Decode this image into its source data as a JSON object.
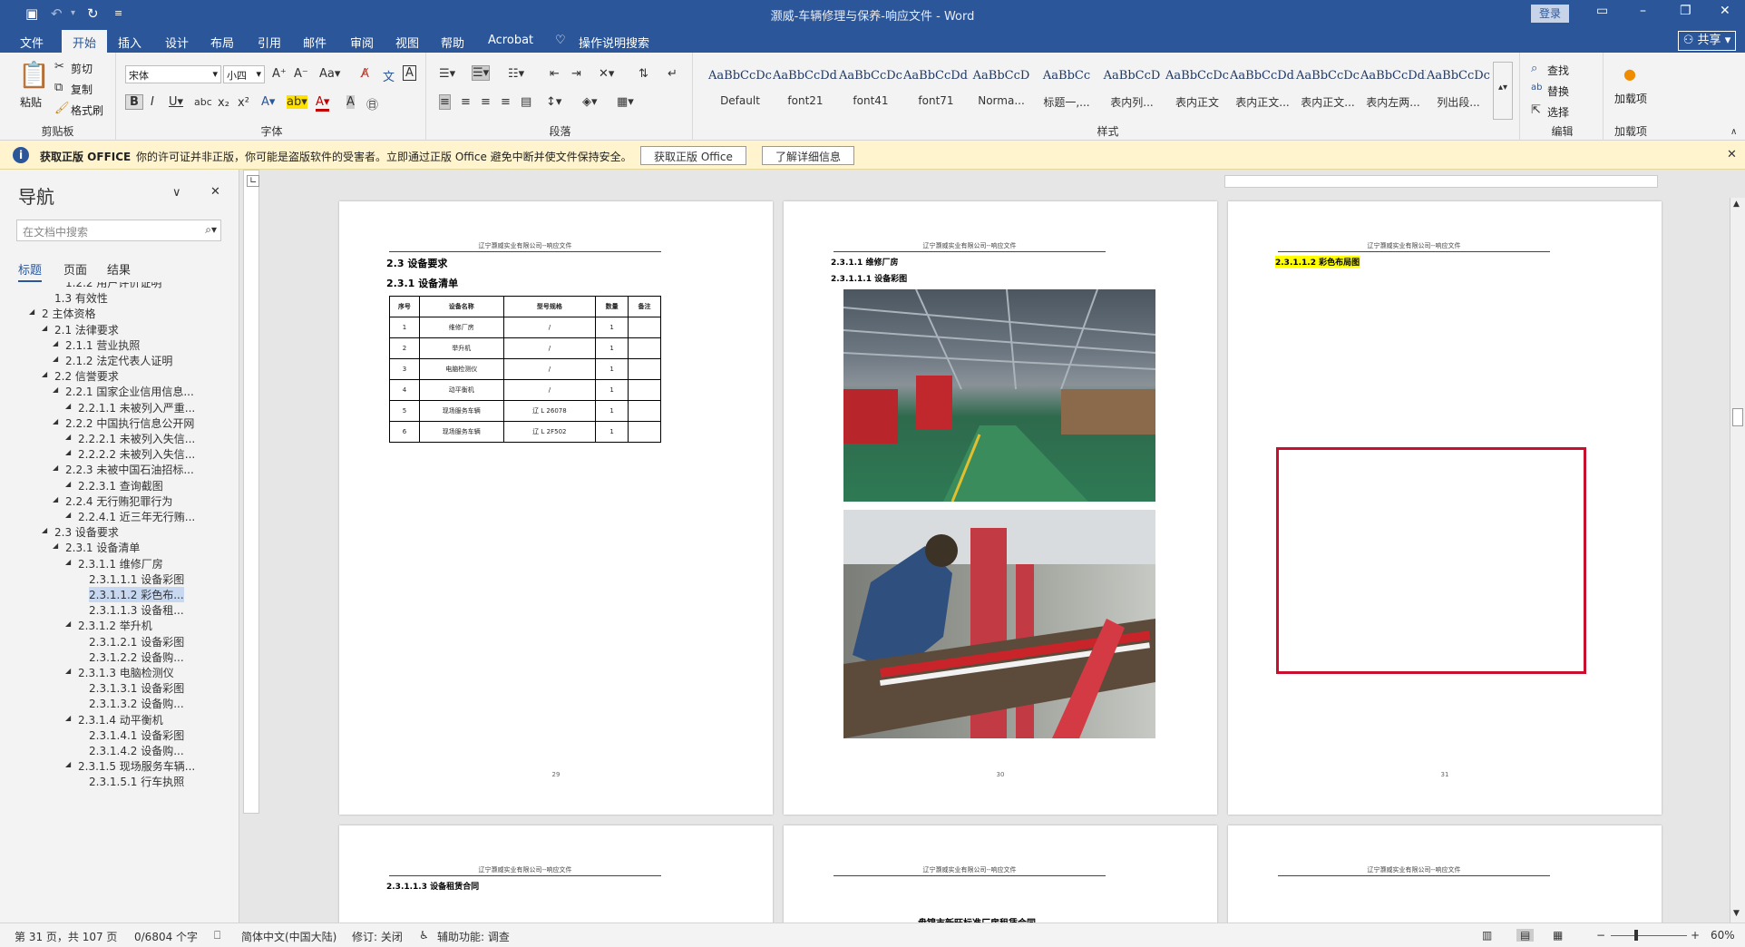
{
  "window": {
    "title": "灏威-车辆修理与保养-响应文件  -  Word",
    "login": "登录"
  },
  "tabs": [
    "文件",
    "开始",
    "插入",
    "设计",
    "布局",
    "引用",
    "邮件",
    "审阅",
    "视图",
    "帮助",
    "Acrobat",
    "操作说明搜索"
  ],
  "share": "共享",
  "ribbon": {
    "clipboard": {
      "label": "剪贴板",
      "paste": "粘贴",
      "cut": "剪切",
      "copy": "复制",
      "painter": "格式刷"
    },
    "font": {
      "label": "字体",
      "name": "宋体",
      "size": "小四"
    },
    "paragraph": {
      "label": "段落"
    },
    "styles": {
      "label": "样式",
      "items": [
        {
          "preview": "AaBbCcDc",
          "name": "Default"
        },
        {
          "preview": "AaBbCcDdE",
          "name": "font21"
        },
        {
          "preview": "AaBbCcDc",
          "name": "font41"
        },
        {
          "preview": "AaBbCcDdEe",
          "name": "font71"
        },
        {
          "preview": "AaBbCcD",
          "name": "Norma..."
        },
        {
          "preview": "AaBbCc",
          "name": "标题一,..."
        },
        {
          "preview": "AaBbCcD",
          "name": "表内列..."
        },
        {
          "preview": "AaBbCcDc",
          "name": "表内正文"
        },
        {
          "preview": "AaBbCcDdI",
          "name": "表内正文..."
        },
        {
          "preview": "AaBbCcDc",
          "name": "表内正文..."
        },
        {
          "preview": "AaBbCcDdl",
          "name": "表内左两..."
        },
        {
          "preview": "AaBbCcDc",
          "name": "列出段..."
        }
      ]
    },
    "editing": {
      "label": "编辑",
      "find": "查找",
      "replace": "替换",
      "select": "选择"
    },
    "addins": {
      "label": "加载项",
      "button": "加载项"
    }
  },
  "infobar": {
    "title": "获取正版 OFFICE",
    "message": "你的许可证并非正版，你可能是盗版软件的受害者。立即通过正版 Office 避免中断并使文件保持安全。",
    "btn1": "获取正版 Office",
    "btn2": "了解详细信息"
  },
  "nav": {
    "title": "导航",
    "search_placeholder": "在文档中搜索",
    "tabs": [
      "标题",
      "页面",
      "结果"
    ],
    "items": [
      {
        "text": "1.2.2 用户评价证明",
        "level": 3
      },
      {
        "text": "1.3 有效性",
        "level": 2
      },
      {
        "text": "2 主体资格",
        "level": 1
      },
      {
        "text": "2.1 法律要求",
        "level": 2
      },
      {
        "text": "2.1.1 营业执照",
        "level": 3
      },
      {
        "text": "2.1.2 法定代表人证明",
        "level": 3
      },
      {
        "text": "2.2 信誉要求",
        "level": 2
      },
      {
        "text": "2.2.1 国家企业信用信息...",
        "level": 3
      },
      {
        "text": "2.2.1.1 未被列入严重...",
        "level": 4
      },
      {
        "text": "2.2.2 中国执行信息公开网",
        "level": 3
      },
      {
        "text": "2.2.2.1 未被列入失信...",
        "level": 4
      },
      {
        "text": "2.2.2.2 未被列入失信...",
        "level": 4
      },
      {
        "text": "2.2.3 未被中国石油招标...",
        "level": 3
      },
      {
        "text": "2.2.3.1 查询截图",
        "level": 4
      },
      {
        "text": "2.2.4 无行贿犯罪行为",
        "level": 3
      },
      {
        "text": "2.2.4.1 近三年无行贿...",
        "level": 4
      },
      {
        "text": "2.3 设备要求",
        "level": 2
      },
      {
        "text": "2.3.1 设备清单",
        "level": 3
      },
      {
        "text": "2.3.1.1 维修厂房",
        "level": 4
      },
      {
        "text": "2.3.1.1.1 设备彩图",
        "level": 5
      },
      {
        "text": "2.3.1.1.2 彩色布...",
        "level": 5
      },
      {
        "text": "2.3.1.1.3 设备租...",
        "level": 5
      },
      {
        "text": "2.3.1.2 举升机",
        "level": 4
      },
      {
        "text": "2.3.1.2.1 设备彩图",
        "level": 5
      },
      {
        "text": "2.3.1.2.2 设备购...",
        "level": 5
      },
      {
        "text": "2.3.1.3 电脑检测仪",
        "level": 4
      },
      {
        "text": "2.3.1.3.1 设备彩图",
        "level": 5
      },
      {
        "text": "2.3.1.3.2 设备购...",
        "level": 5
      },
      {
        "text": "2.3.1.4 动平衡机",
        "level": 4
      },
      {
        "text": "2.3.1.4.1 设备彩图",
        "level": 5
      },
      {
        "text": "2.3.1.4.2 设备购...",
        "level": 5
      },
      {
        "text": "2.3.1.5 现场服务车辆...",
        "level": 4
      },
      {
        "text": "2.3.1.5.1 行车执照",
        "level": 5
      }
    ]
  },
  "pages": {
    "header": "辽宁灏威实业有限公司--响应文件",
    "p1": {
      "h1": "2.3 设备要求",
      "h2": "2.3.1 设备清单",
      "num": "29",
      "table": {
        "head": [
          "序号",
          "设备名称",
          "型号规格",
          "数量",
          "备注"
        ],
        "rows": [
          [
            "1",
            "维修厂房",
            "/",
            "1",
            ""
          ],
          [
            "2",
            "举升机",
            "/",
            "1",
            ""
          ],
          [
            "3",
            "电脑检测仪",
            "/",
            "1",
            ""
          ],
          [
            "4",
            "动平衡机",
            "/",
            "1",
            ""
          ],
          [
            "5",
            "现场服务车辆",
            "辽 L 26078",
            "1",
            ""
          ],
          [
            "6",
            "现场服务车辆",
            "辽 L 2F502",
            "1",
            ""
          ]
        ]
      }
    },
    "p2": {
      "h1": "2.3.1.1 维修厂房",
      "h2": "2.3.1.1.1 设备彩图",
      "num": "30"
    },
    "p3": {
      "h1": "2.3.1.1.2 彩色布局图",
      "num": "31"
    },
    "p4": {
      "h1": "2.3.1.1.3 设备租赁合同"
    },
    "p5": {
      "text": "盘锦市新旺标准厂房租赁合同"
    }
  },
  "status": {
    "page": "第 31 页，共 107 页",
    "words": "0/6804 个字",
    "lang": "简体中文(中国大陆)",
    "track": "修订: 关闭",
    "access": "辅助功能: 调查",
    "zoom": "60%"
  }
}
